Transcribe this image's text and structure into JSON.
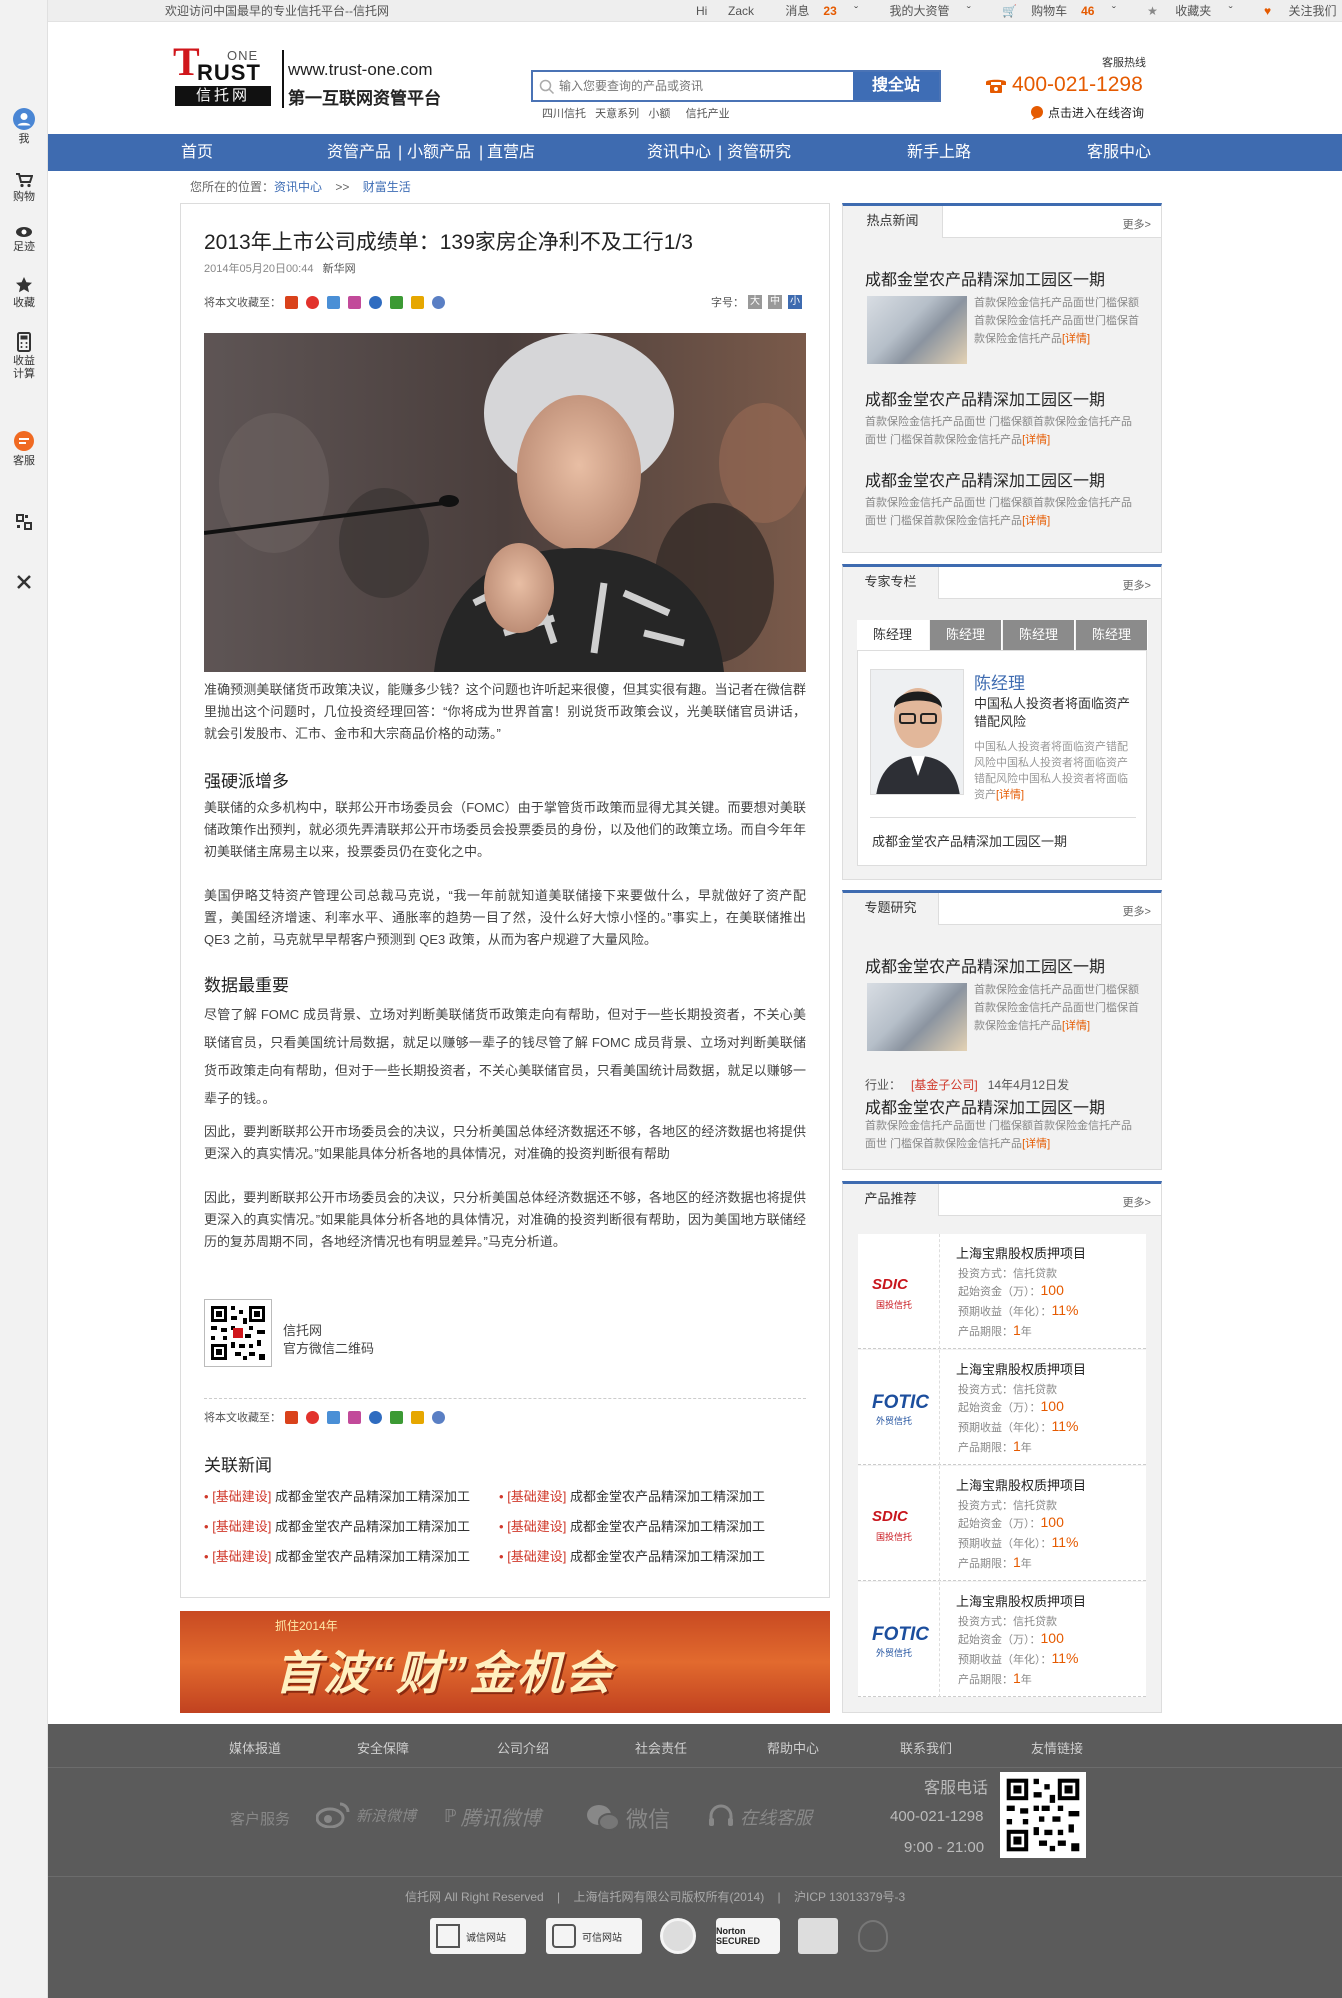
{
  "topbar": {
    "welcome": "欢迎访问中国最早的专业信托平台--信托网",
    "hi": "Hi",
    "user": "Zack",
    "msg_label": "消息",
    "msg_count": "23",
    "assets": "我的大资管",
    "cart_label": "购物车",
    "cart_count": "46",
    "fav": "收藏夹",
    "follow": "关注我们"
  },
  "sidebar": {
    "me": "我",
    "cart": "购物",
    "footprint": "足迹",
    "fav": "收藏",
    "calc1": "收益",
    "calc2": "计算",
    "service": "客服"
  },
  "header": {
    "logo_one": "ONE",
    "logo_trust": "RUST",
    "logo_trust_t": "T",
    "logo_cn": "信托网",
    "site_url": "www.trust-one.com",
    "slogan": "第一互联网资管平台",
    "search_placeholder": "输入您要查询的产品或资讯",
    "search_btn": "搜全站",
    "hot_words": [
      "四川信托",
      "天意系列",
      "小额",
      "信托产业"
    ],
    "hotline_label": "客服热线",
    "hotline": "400-021-1298",
    "online": "点击进入在线咨询"
  },
  "nav": {
    "home": "首页",
    "assets": "资管产品",
    "small": "小额产品",
    "direct": "直营店",
    "info": "资讯中心",
    "research": "资管研究",
    "newbie": "新手上路",
    "service": "客服中心",
    "sep": "|"
  },
  "breadcrumb": {
    "prefix": "您所在的位置：",
    "level1": "资讯中心",
    "sep": ">>",
    "level2": "财富生活"
  },
  "article": {
    "title": "2013年上市公司成绩单：139家房企净利不及工行1/3",
    "date": "2014年05月20日00:44",
    "source": "新华网",
    "share_label": "将本文收藏至：",
    "font_label": "字号：",
    "font_sizes": [
      "大",
      "中",
      "小"
    ],
    "p1": "准确预测美联储货币政策决议，能赚多少钱？这个问题也许听起来很傻，但其实很有趣。当记者在微信群里抛出这个问题时，几位投资经理回答：“你将成为世界首富！别说货币政策会议，光美联储官员讲话，就会引发股市、汇市、金市和大宗商品价格的动荡。”",
    "h1": "强硬派增多",
    "p2": "美联储的众多机构中，联邦公开市场委员会（FOMC）由于掌管货币政策而显得尤其关键。而要想对美联储政策作出预判，就必须先弄清联邦公开市场委员会投票委员的身份，以及他们的政策立场。而自今年年初美联储主席易主以来，投票委员仍在变化之中。",
    "p3": "美国伊略艾特资产管理公司总裁马克说，“我一年前就知道美联储接下来要做什么，早就做好了资产配置，美国经济增速、利率水平、通胀率的趋势一目了然，没什么好大惊小怪的。”事实上，在美联储推出 QE3 之前，马克就早早帮客户预测到 QE3 政策，从而为客户规避了大量风险。",
    "h2": "数据最重要",
    "p4": "尽管了解 FOMC 成员背景、立场对判断美联储货币政策走向有帮助，但对于一些长期投资者，不关心美联储官员，只看美国统计局数据，就足以赚够一辈子的钱尽管了解 FOMC 成员背景、立场对判断美联储货币政策走向有帮助，但对于一些长期投资者，不关心美联储官员，只看美国统计局数据，就足以赚够一辈子的钱。。",
    "p5": "因此，要判断联邦公开市场委员会的决议，只分析美国总体经济数据还不够，各地区的经济数据也将提供更深入的真实情况。”如果能具体分析各地的具体情况，对准确的投资判断很有帮助",
    "p6": "因此，要判断联邦公开市场委员会的决议，只分析美国总体经济数据还不够，各地区的经济数据也将提供更深入的真实情况。”如果能具体分析各地的具体情况，对准确的投资判断很有帮助，因为美国地方联储经历的复苏周期不同，各地经济情况也有明显差异。”马克分析道。",
    "qr_name": "信托网",
    "qr_desc": "官方微信二维码",
    "related_title": "关联新闻",
    "related_tag": "[基础建设]",
    "related_text": "成都金堂农产品精深加工精深加工"
  },
  "hot_news": {
    "tab": "热点新闻",
    "more": "更多>",
    "title": "成都金堂农产品精深加工园区一期",
    "text1": "首款保险金信托产品面世门槛保额首款保险金信托产品面世门槛保首款保险金信托产品",
    "text2a": "首款保险金信托产品面世 门槛保额首款保险金信托产品",
    "text2b": "面世 门槛保首款保险金信托产品",
    "detail": "[详情]"
  },
  "expert": {
    "tab": "专家专栏",
    "more": "更多>",
    "tabs": [
      "陈经理",
      "陈经理",
      "陈经理",
      "陈经理"
    ],
    "name": "陈经理",
    "headline": "中国私人投资者将面临资产错配风险",
    "desc": "中国私人投资者将面临资产错配风险中国私人投资者将面临资产错配风险中国私人投资者将面临资产",
    "detail": "[详情]",
    "link": "成都金堂农产品精深加工园区一期"
  },
  "research": {
    "tab": "专题研究",
    "more": "更多>",
    "title": "成都金堂农产品精深加工园区一期",
    "text1": "首款保险金信托产品面世门槛保额首款保险金信托产品面世门槛保首款保险金信托产品",
    "detail": "[详情]",
    "industry_label": "行业：",
    "industry_tag": "[基金子公司]",
    "industry_date": "14年4月12日发",
    "title2": "成都金堂农产品精深加工园区一期",
    "text2a": "首款保险金信托产品面世 门槛保额首款保险金信托产品",
    "text2b": "面世 门槛保首款保险金信托产品"
  },
  "products": {
    "tab": "产品推荐",
    "more": "更多>",
    "items": [
      {
        "logo": "SDIC",
        "logo_cn": "国投信托",
        "name": "上海宝鼎股权质押项目",
        "invest_label": "投资方式：",
        "invest": "信托贷款",
        "start_label": "起始资金（万）：",
        "start": "100",
        "yield_label": "预期收益（年化）：",
        "yield": "11%",
        "term_label": "产品期限：",
        "term": "1",
        "term_unit": "年"
      },
      {
        "logo": "FOTIC",
        "logo_cn": "外贸信托",
        "name": "上海宝鼎股权质押项目",
        "invest_label": "投资方式：",
        "invest": "信托贷款",
        "start_label": "起始资金（万）：",
        "start": "100",
        "yield_label": "预期收益（年化）：",
        "yield": "11%",
        "term_label": "产品期限：",
        "term": "1",
        "term_unit": "年"
      },
      {
        "logo": "SDIC",
        "logo_cn": "国投信托",
        "name": "上海宝鼎股权质押项目",
        "invest_label": "投资方式：",
        "invest": "信托贷款",
        "start_label": "起始资金（万）：",
        "start": "100",
        "yield_label": "预期收益（年化）：",
        "yield": "11%",
        "term_label": "产品期限：",
        "term": "1",
        "term_unit": "年"
      },
      {
        "logo": "FOTIC",
        "logo_cn": "外贸信托",
        "name": "上海宝鼎股权质押项目",
        "invest_label": "投资方式：",
        "invest": "信托贷款",
        "start_label": "起始资金（万）：",
        "start": "100",
        "yield_label": "预期收益（年化）：",
        "yield": "11%",
        "term_label": "产品期限：",
        "term": "1",
        "term_unit": "年"
      }
    ]
  },
  "ad": {
    "small": "抓住2014年",
    "big": "首波“财”金机会"
  },
  "footer": {
    "links": [
      "媒体报道",
      "安全保障",
      "公司介绍",
      "社会责任",
      "帮助中心",
      "联系我们",
      "友情链接"
    ],
    "svc_label": "客户服务",
    "weibo": "新浪微博",
    "tencent": "腾讯微博",
    "wechat": "微信",
    "online": "在线客服",
    "phone_label": "客服电话",
    "phone": "400-021-1298",
    "hours": "9:00 - 21:00",
    "copyright": "信托网 All Right Reserved",
    "company": "上海信托网有限公司版权所有(2014)",
    "icp": "沪ICP 13013379号-3",
    "badge1": "诚信网站",
    "badge2": "可信网站",
    "badge3": "Norton SECURED"
  }
}
